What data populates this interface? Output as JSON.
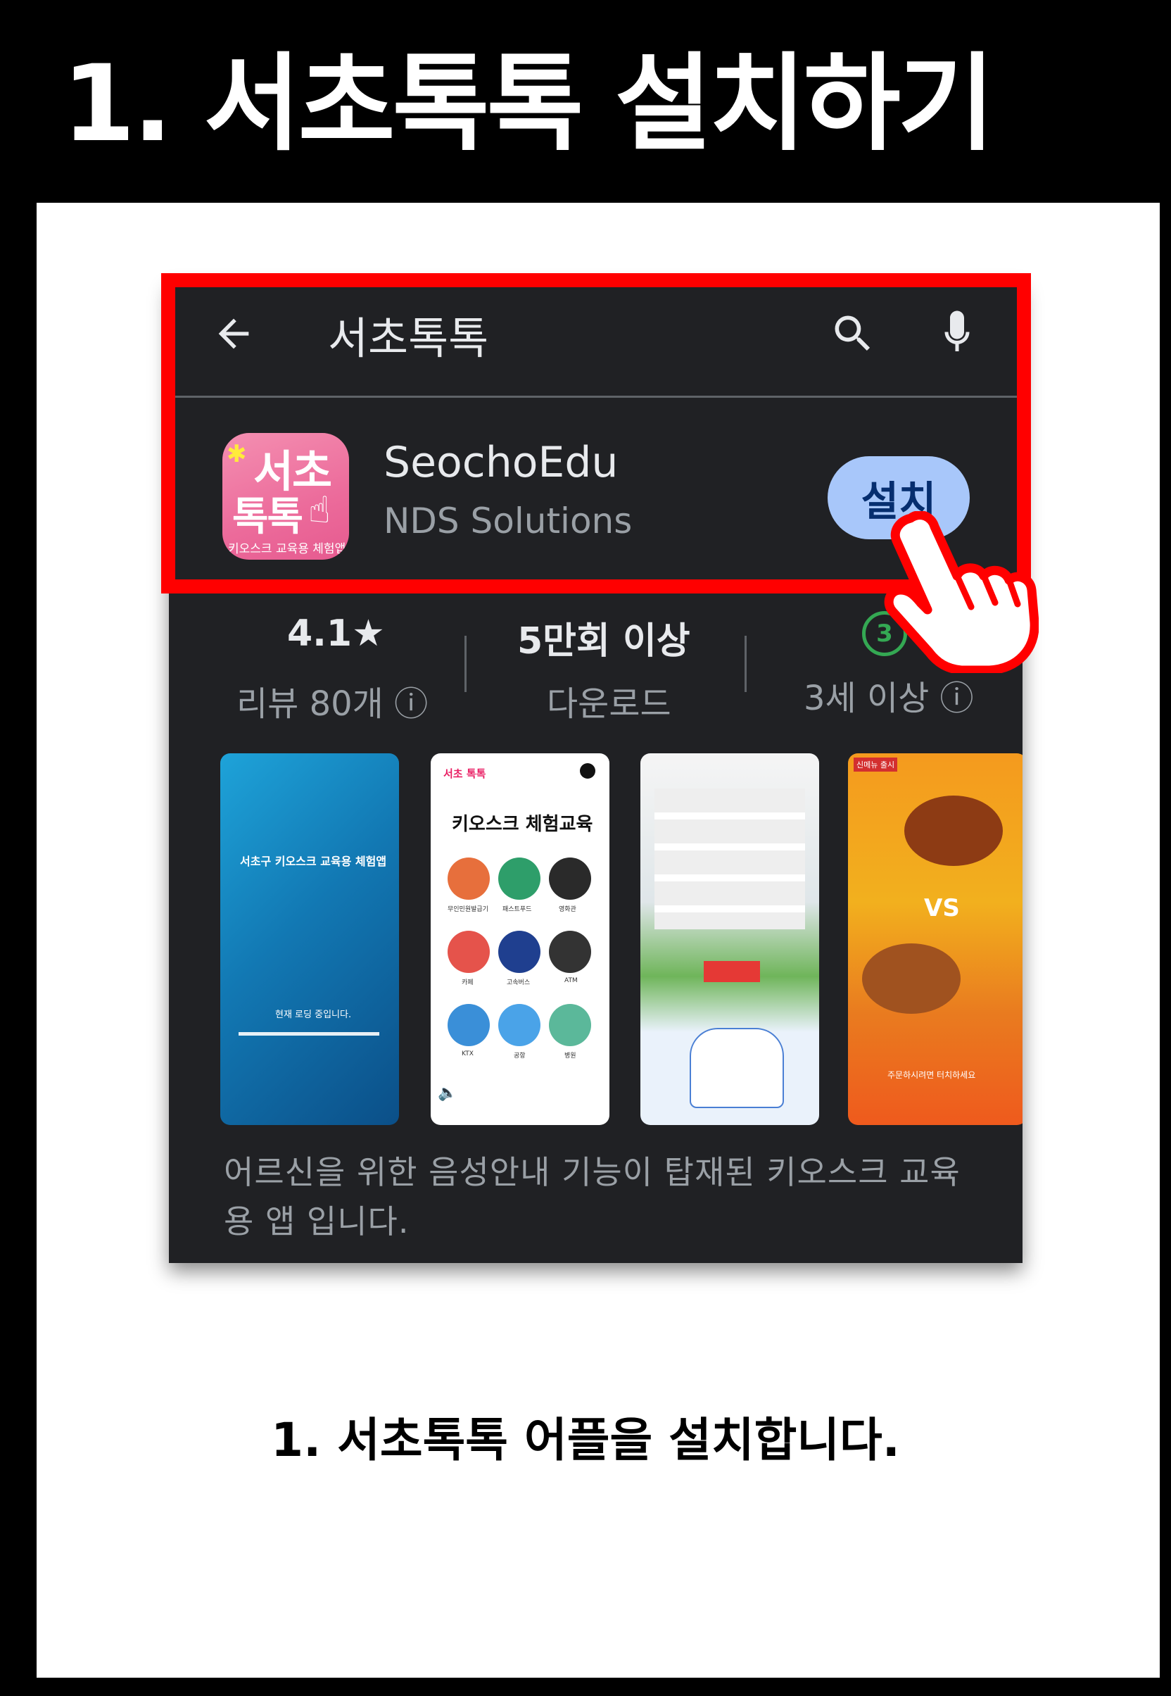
{
  "header": {
    "title": "1. 서초톡톡 설치하기"
  },
  "search_bar": {
    "query": "서초톡톡"
  },
  "app": {
    "icon_lines": [
      "서초",
      "톡톡",
      "키오스크 교육용 체험앱"
    ],
    "name": "SeochoEdu",
    "developer": "NDS Solutions",
    "install_label": "설치"
  },
  "stats": [
    {
      "value": "4.1★",
      "label": "리뷰 80개 ⓘ"
    },
    {
      "value": "5만회 이상",
      "label": "다운로드"
    },
    {
      "value": "3",
      "label": "3세 이상 ⓘ"
    }
  ],
  "screenshots": {
    "s1_title": "서초구 키오스크 교육용 체험앱",
    "s1_loading": "현재 로딩 중입니다.",
    "s2_logo": "서초 톡톡",
    "s2_title": "키오스크 체험교육",
    "s2_items": [
      "무인민원발급기",
      "패스트푸드",
      "영화관",
      "카페",
      "고속버스",
      "ATM",
      "KTX",
      "공항",
      "병원"
    ],
    "s4_badge": "신메뉴 출시",
    "s4_vs": "VS",
    "s4_footer": "주문하시려면 터치하세요"
  },
  "description": "어르신을 위한 음성안내 기능이 탑재된 키오스크 교육용 앱 입니다.",
  "caption": "1. 서초톡톡 어플을 설치합니다.",
  "colors": {
    "highlight": "#ff0000",
    "install_bg": "#a8c7fa",
    "dark_bg": "#202124"
  }
}
